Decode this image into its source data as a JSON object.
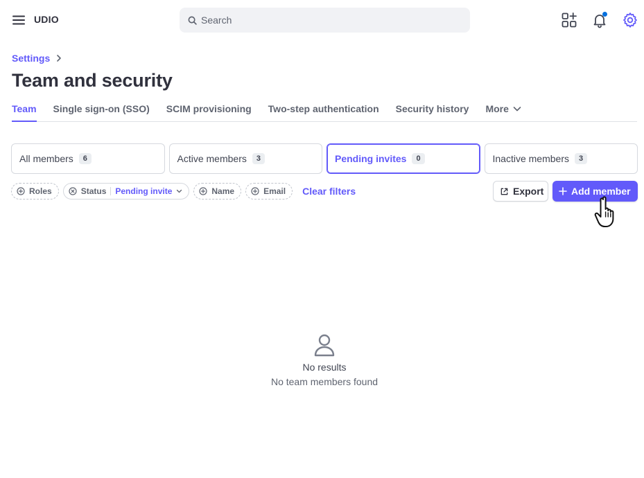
{
  "app": {
    "name": "UDIO"
  },
  "search": {
    "placeholder": "Search"
  },
  "icons": {
    "menu": "menu-icon",
    "search": "search-icon",
    "apps": "apps-add-icon",
    "notifications": "bell-icon",
    "settings": "gear-icon"
  },
  "colors": {
    "accent": "#625afa",
    "notification_dot": "#0570de"
  },
  "breadcrumb": {
    "parent": "Settings"
  },
  "page": {
    "title": "Team and security"
  },
  "tabs": [
    {
      "label": "Team",
      "active": true
    },
    {
      "label": "Single sign-on (SSO)"
    },
    {
      "label": "SCIM provisioning"
    },
    {
      "label": "Two-step authentication"
    },
    {
      "label": "Security history"
    },
    {
      "label": "More"
    }
  ],
  "member_filters": [
    {
      "label": "All members",
      "count": "6"
    },
    {
      "label": "Active members",
      "count": "3"
    },
    {
      "label": "Pending invites",
      "count": "0",
      "selected": true
    },
    {
      "label": "Inactive members",
      "count": "3"
    }
  ],
  "filters": {
    "roles": "Roles",
    "status": "Status",
    "status_value": "Pending invite",
    "name": "Name",
    "email": "Email",
    "clear": "Clear filters"
  },
  "actions": {
    "export": "Export",
    "add_member": "Add member"
  },
  "empty_state": {
    "title": "No results",
    "message": "No team members found"
  }
}
